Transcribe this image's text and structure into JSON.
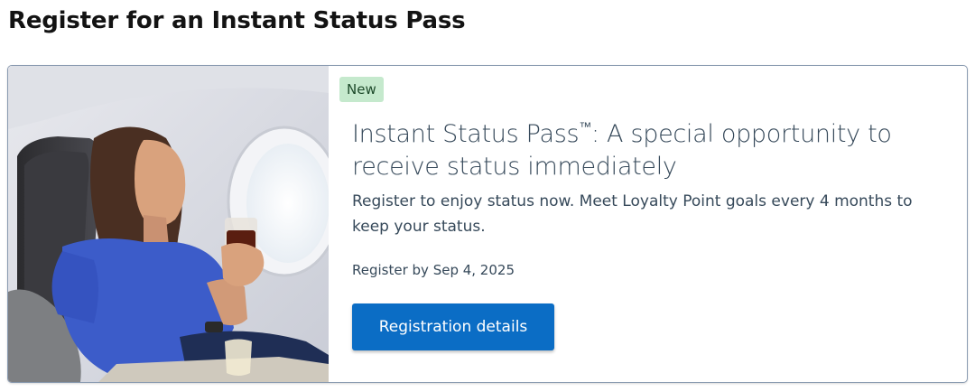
{
  "page": {
    "title": "Register for an Instant Status Pass"
  },
  "card": {
    "badge": "New",
    "headline_main": "Instant Status Pass",
    "headline_tm": "™",
    "headline_rest": ": A special opportunity to receive status immediately",
    "description": "Register to enjoy status now. Meet Loyalty Point goals every 4 months to keep your status.",
    "deadline": "Register by Sep 4, 2025",
    "cta_label": "Registration details"
  },
  "colors": {
    "badge_bg": "#c5e9cd",
    "cta_bg": "#0b6dc5",
    "text": "#36495a",
    "border": "#8a9bb1"
  }
}
